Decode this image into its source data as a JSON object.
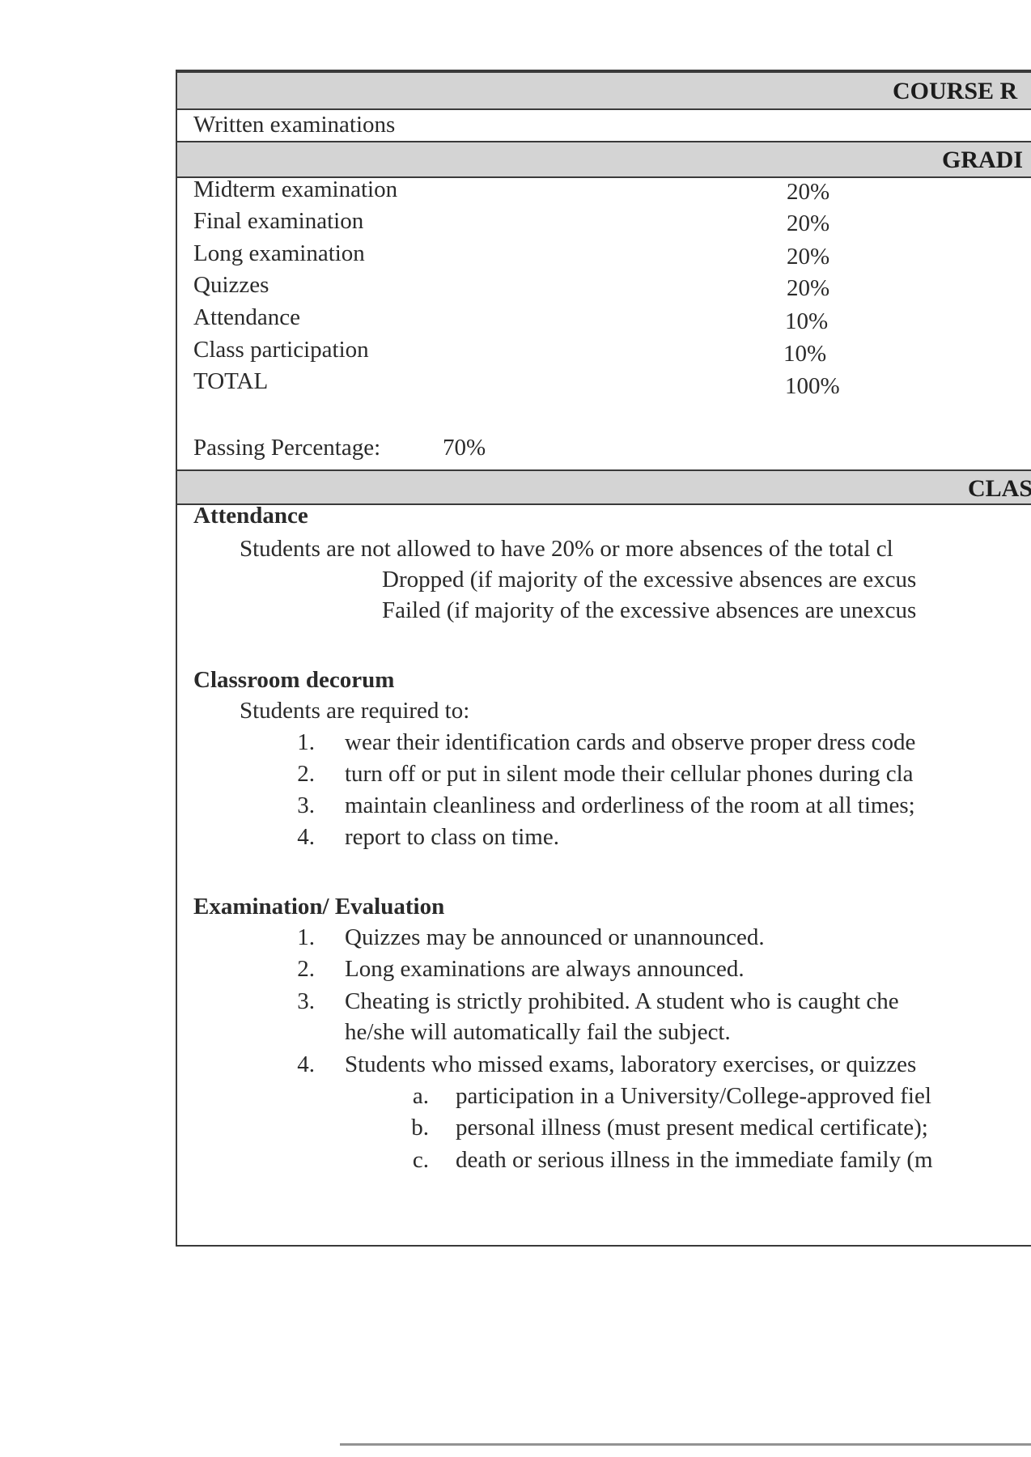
{
  "sections": {
    "course_requirements": {
      "title": "COURSE R",
      "items": [
        "Written examinations"
      ]
    },
    "grading": {
      "title": "GRADI",
      "rows": [
        {
          "label": "Midterm examination",
          "value": "20%"
        },
        {
          "label": "Final examination",
          "value": "20%"
        },
        {
          "label": "Long examination",
          "value": "20%"
        },
        {
          "label": "Quizzes",
          "value": "20%"
        },
        {
          "label": "Attendance",
          "value": "10%"
        },
        {
          "label": "Class participation",
          "value": "10%"
        },
        {
          "label": "TOTAL",
          "value": "100%"
        }
      ],
      "passing_label": "Passing Percentage:",
      "passing_value": "70%"
    },
    "class": {
      "title": "CLAS",
      "attendance": {
        "heading": "Attendance",
        "lines": [
          "Students are not allowed to have 20% or more absences of the total cl",
          "Dropped (if majority of the excessive absences are excus",
          "Failed (if majority of the excessive absences are unexcus"
        ]
      },
      "decorum": {
        "heading": "Classroom decorum",
        "intro": "Students are required to:",
        "items": [
          {
            "num": "1.",
            "text": "wear their identification cards and observe proper dress code"
          },
          {
            "num": "2.",
            "text": "turn off or put in silent mode their cellular phones during cla"
          },
          {
            "num": "3.",
            "text": "maintain cleanliness and orderliness of the room at all times;"
          },
          {
            "num": "4.",
            "text": "report to class on time."
          }
        ]
      },
      "exam": {
        "heading": "Examination/ Evaluation",
        "items": [
          {
            "num": "1.",
            "text": "Quizzes may be announced or unannounced."
          },
          {
            "num": "2.",
            "text": "Long examinations are always announced."
          },
          {
            "num": "3.",
            "text": "Cheating is strictly prohibited. A student who is caught che",
            "cont": "he/she will automatically fail the subject."
          },
          {
            "num": "4.",
            "text": "Students who missed exams, laboratory exercises, or quizzes"
          }
        ],
        "subitems": [
          {
            "num": "a.",
            "text": "participation in a University/College-approved fiel"
          },
          {
            "num": "b.",
            "text": "personal illness (must present medical certificate);"
          },
          {
            "num": "c.",
            "text": "death or serious illness in the immediate family (m"
          }
        ]
      }
    }
  }
}
